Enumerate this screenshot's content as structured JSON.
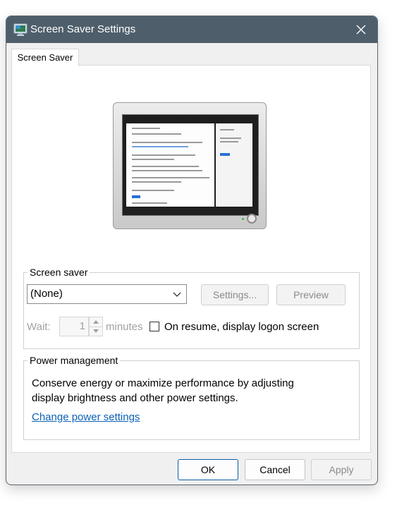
{
  "window": {
    "title": "Screen Saver Settings",
    "icon": "screen-saver-app-icon",
    "close_icon": "close-icon"
  },
  "tabs": [
    {
      "label": "Screen Saver"
    }
  ],
  "screen_saver": {
    "group_label": "Screen saver",
    "selected": "(None)",
    "settings_label": "Settings...",
    "preview_label": "Preview",
    "wait_label": "Wait:",
    "wait_value": "1",
    "minutes_label": "minutes",
    "resume_label": "On resume, display logon screen",
    "resume_checked": false
  },
  "power_management": {
    "group_label": "Power management",
    "description_line1": "Conserve energy or maximize performance by adjusting",
    "description_line2": "display brightness and other power settings.",
    "link_label": "Change power settings"
  },
  "footer": {
    "ok_label": "OK",
    "cancel_label": "Cancel",
    "apply_label": "Apply"
  },
  "colors": {
    "titlebar": "#4e5f6b",
    "link": "#0b62b5",
    "primary_border": "#0b5ea8"
  }
}
